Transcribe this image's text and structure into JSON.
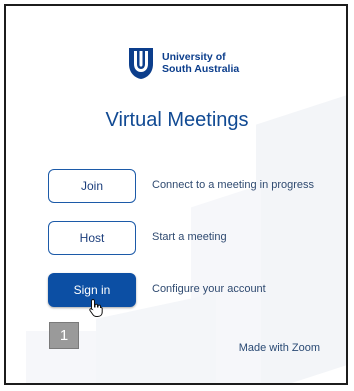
{
  "brand": {
    "line1": "University of",
    "line2": "South Australia"
  },
  "title": "Virtual Meetings",
  "actions": [
    {
      "label": "Join",
      "description": "Connect to a meeting in progress"
    },
    {
      "label": "Host",
      "description": "Start a meeting"
    },
    {
      "label": "Sign in",
      "description": "Configure your account"
    }
  ],
  "step_badge": "1",
  "footer": "Made with Zoom",
  "colors": {
    "primary": "#0c4fa4",
    "brand_text": "#0c3e8c",
    "title": "#114a93"
  }
}
